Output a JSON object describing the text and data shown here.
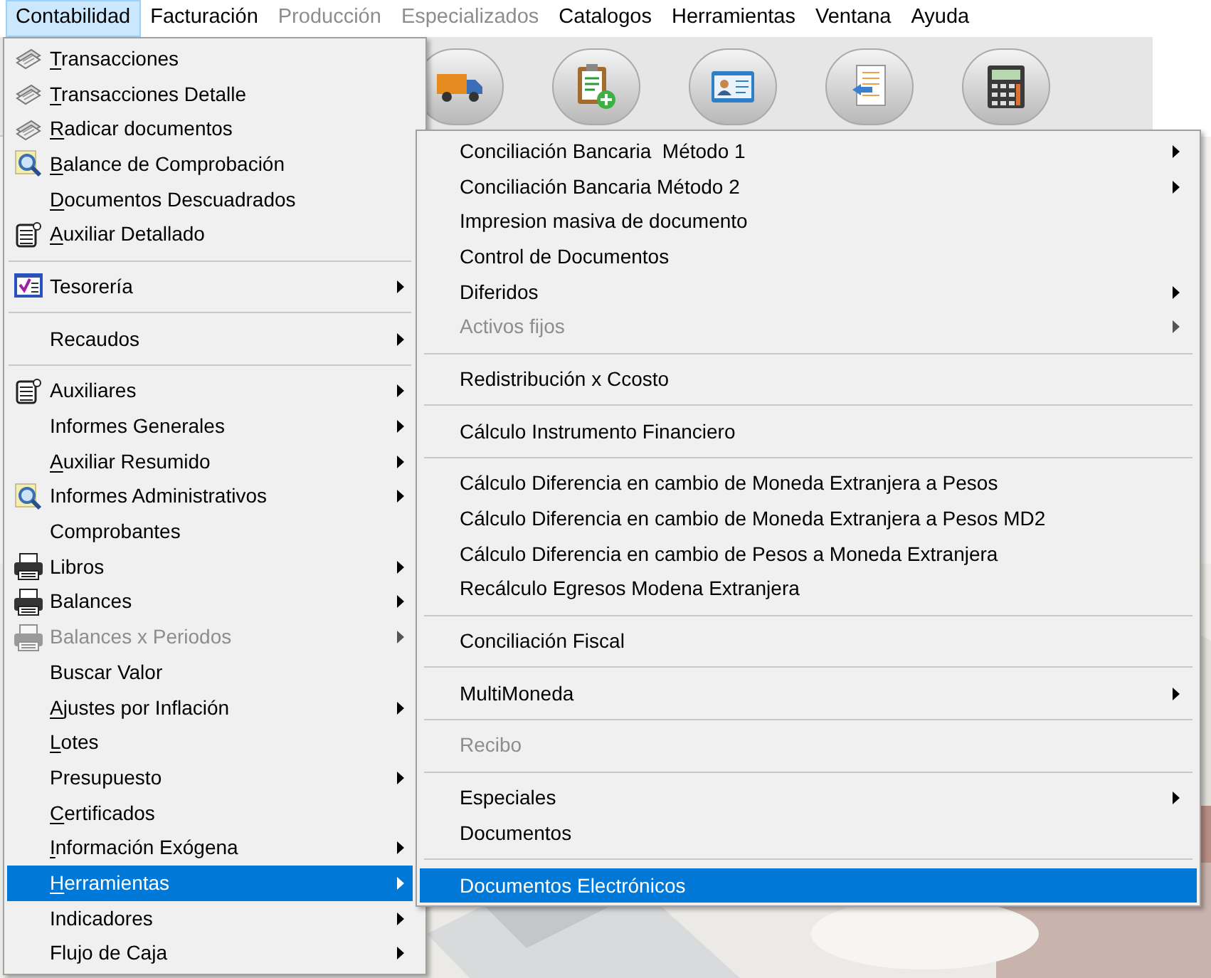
{
  "menu_bar": [
    {
      "label": "Contabilidad",
      "selected": true,
      "disabled": false
    },
    {
      "label": "Facturación",
      "selected": false,
      "disabled": false
    },
    {
      "label": "Producción",
      "selected": false,
      "disabled": true
    },
    {
      "label": "Especializados",
      "selected": false,
      "disabled": true
    },
    {
      "label": "Catalogos",
      "selected": false,
      "disabled": false
    },
    {
      "label": "Herramientas",
      "selected": false,
      "disabled": false
    },
    {
      "label": "Ventana",
      "selected": false,
      "disabled": false
    },
    {
      "label": "Ayuda",
      "selected": false,
      "disabled": false
    }
  ],
  "menu": [
    {
      "kind": "item",
      "label": "Transacciones",
      "mnemonic": true,
      "submenu": false,
      "disabled": false,
      "selected": false
    },
    {
      "kind": "item",
      "label": "Transacciones Detalle",
      "mnemonic": true,
      "submenu": false,
      "disabled": false,
      "selected": false
    },
    {
      "kind": "item",
      "label": "Radicar documentos",
      "mnemonic": true,
      "submenu": false,
      "disabled": false,
      "selected": false
    },
    {
      "kind": "item",
      "label": "Balance de Comprobación",
      "mnemonic": true,
      "submenu": false,
      "disabled": false,
      "selected": false
    },
    {
      "kind": "item",
      "label": "Documentos Descuadrados",
      "mnemonic": true,
      "submenu": false,
      "disabled": false,
      "selected": false
    },
    {
      "kind": "item",
      "label": "Auxiliar Detallado",
      "mnemonic": true,
      "submenu": false,
      "disabled": false,
      "selected": false
    },
    {
      "kind": "separator"
    },
    {
      "kind": "item",
      "label": "Tesorería",
      "mnemonic": false,
      "submenu": true,
      "disabled": false,
      "selected": false
    },
    {
      "kind": "separator"
    },
    {
      "kind": "item",
      "label": "Recaudos",
      "mnemonic": false,
      "submenu": true,
      "disabled": false,
      "selected": false
    },
    {
      "kind": "separator"
    },
    {
      "kind": "item",
      "label": "Auxiliares",
      "mnemonic": false,
      "submenu": true,
      "disabled": false,
      "selected": false
    },
    {
      "kind": "item",
      "label": "Informes Generales",
      "mnemonic": false,
      "submenu": true,
      "disabled": false,
      "selected": false
    },
    {
      "kind": "item",
      "label": "Auxiliar Resumido",
      "mnemonic": true,
      "submenu": true,
      "disabled": false,
      "selected": false
    },
    {
      "kind": "item",
      "label": "Informes Administrativos",
      "mnemonic": false,
      "submenu": true,
      "disabled": false,
      "selected": false
    },
    {
      "kind": "item",
      "label": "Comprobantes",
      "mnemonic": false,
      "submenu": false,
      "disabled": false,
      "selected": false
    },
    {
      "kind": "item",
      "label": "Libros",
      "mnemonic": false,
      "submenu": true,
      "disabled": false,
      "selected": false
    },
    {
      "kind": "item",
      "label": "Balances",
      "mnemonic": false,
      "submenu": true,
      "disabled": false,
      "selected": false
    },
    {
      "kind": "item",
      "label": "Balances x Periodos",
      "mnemonic": false,
      "submenu": true,
      "disabled": true,
      "selected": false
    },
    {
      "kind": "item",
      "label": "Buscar Valor",
      "mnemonic": false,
      "submenu": false,
      "disabled": false,
      "selected": false
    },
    {
      "kind": "item",
      "label": "Ajustes por Inflación",
      "mnemonic": true,
      "submenu": true,
      "disabled": false,
      "selected": false
    },
    {
      "kind": "item",
      "label": "Lotes",
      "mnemonic": true,
      "submenu": false,
      "disabled": false,
      "selected": false
    },
    {
      "kind": "item",
      "label": "Presupuesto",
      "mnemonic": false,
      "submenu": true,
      "disabled": false,
      "selected": false
    },
    {
      "kind": "item",
      "label": "Certificados",
      "mnemonic": true,
      "submenu": false,
      "disabled": false,
      "selected": false
    },
    {
      "kind": "item",
      "label": "Información Exógena",
      "mnemonic": true,
      "submenu": true,
      "disabled": false,
      "selected": false
    },
    {
      "kind": "item",
      "label": "Herramientas",
      "mnemonic": true,
      "submenu": true,
      "disabled": false,
      "selected": true
    },
    {
      "kind": "item",
      "label": "Indicadores",
      "mnemonic": false,
      "submenu": true,
      "disabled": false,
      "selected": false
    },
    {
      "kind": "item",
      "label": "Flujo de Caja",
      "mnemonic": false,
      "submenu": true,
      "disabled": false,
      "selected": false
    }
  ],
  "submenu": [
    {
      "kind": "item",
      "label": "Conciliación Bancaria  Método 1",
      "submenu": true,
      "disabled": false,
      "selected": false
    },
    {
      "kind": "item",
      "label": "Conciliación Bancaria Método 2",
      "submenu": true,
      "disabled": false,
      "selected": false
    },
    {
      "kind": "item",
      "label": "Impresion masiva de documento",
      "submenu": false,
      "disabled": false,
      "selected": false
    },
    {
      "kind": "item",
      "label": "Control de Documentos",
      "submenu": false,
      "disabled": false,
      "selected": false
    },
    {
      "kind": "item",
      "label": "Diferidos",
      "submenu": true,
      "disabled": false,
      "selected": false
    },
    {
      "kind": "item",
      "label": "Activos fijos",
      "submenu": true,
      "disabled": true,
      "selected": false
    },
    {
      "kind": "separator"
    },
    {
      "kind": "item",
      "label": "Redistribución x Ccosto",
      "submenu": false,
      "disabled": false,
      "selected": false
    },
    {
      "kind": "separator"
    },
    {
      "kind": "item",
      "label": "Cálculo Instrumento Financiero",
      "submenu": false,
      "disabled": false,
      "selected": false
    },
    {
      "kind": "separator"
    },
    {
      "kind": "item",
      "label": "Cálculo Diferencia en cambio de Moneda Extranjera a Pesos",
      "submenu": false,
      "disabled": false,
      "selected": false
    },
    {
      "kind": "item",
      "label": "Cálculo Diferencia en cambio de Moneda Extranjera a Pesos MD2",
      "submenu": false,
      "disabled": false,
      "selected": false
    },
    {
      "kind": "item",
      "label": "Cálculo Diferencia en cambio de Pesos a Moneda Extranjera",
      "submenu": false,
      "disabled": false,
      "selected": false
    },
    {
      "kind": "item",
      "label": "Recálculo Egresos Modena Extranjera",
      "submenu": false,
      "disabled": false,
      "selected": false
    },
    {
      "kind": "separator"
    },
    {
      "kind": "item",
      "label": "Conciliación Fiscal",
      "submenu": false,
      "disabled": false,
      "selected": false
    },
    {
      "kind": "separator"
    },
    {
      "kind": "item",
      "label": "MultiMoneda",
      "submenu": true,
      "disabled": false,
      "selected": false
    },
    {
      "kind": "separator"
    },
    {
      "kind": "item",
      "label": "Recibo",
      "submenu": false,
      "disabled": true,
      "selected": false
    },
    {
      "kind": "separator"
    },
    {
      "kind": "item",
      "label": "Especiales",
      "submenu": true,
      "disabled": false,
      "selected": false
    },
    {
      "kind": "item",
      "label": "Documentos",
      "submenu": false,
      "disabled": false,
      "selected": false
    },
    {
      "kind": "separator"
    },
    {
      "kind": "item",
      "label": "Documentos Electrónicos",
      "submenu": false,
      "disabled": false,
      "selected": true
    }
  ]
}
